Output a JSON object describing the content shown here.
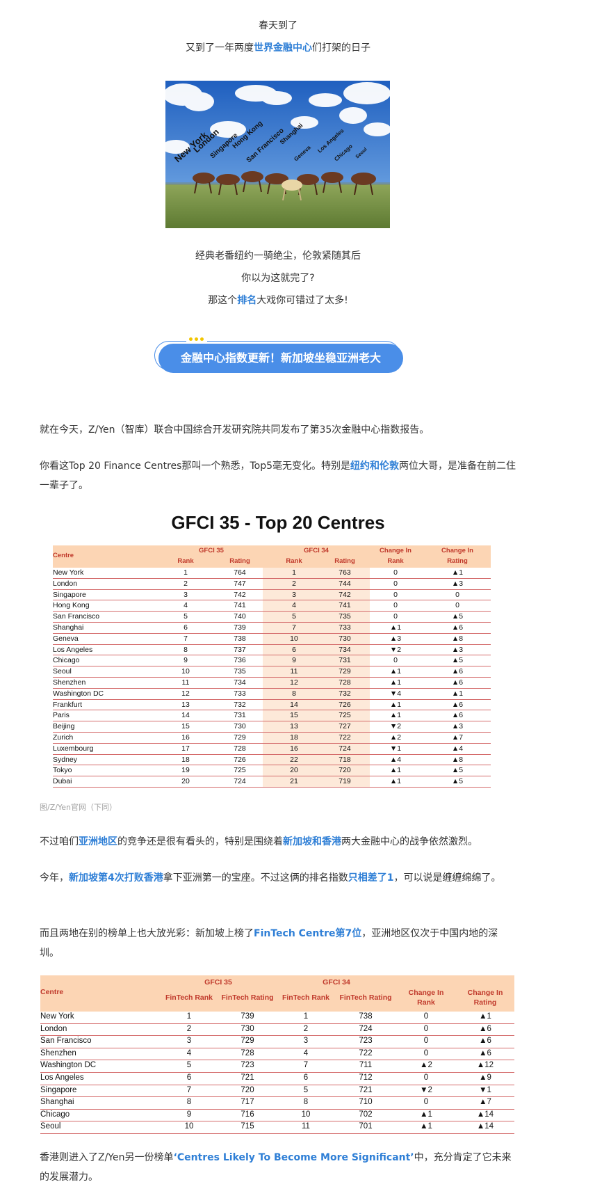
{
  "intro": {
    "line1": "春天到了",
    "line2_pre": "又到了一年两度",
    "line2_hl": "世界金融中心",
    "line2_post": "们打架的日子"
  },
  "photo": {
    "labels": [
      "New York",
      "London",
      "Singapore",
      "Hong Kong",
      "San Francisco",
      "Shanghai",
      "Geneva",
      "Los Angeles",
      "Chicago",
      "Seoul"
    ]
  },
  "after_photo": {
    "line1": "经典老番纽约一骑绝尘，伦敦紧随其后",
    "line2": "你以为这就完了?",
    "line3_pre": "那这个",
    "line3_hl": "排名",
    "line3_post": "大戏你可错过了太多!"
  },
  "badge": {
    "text": "金融中心指数更新！新加坡坐稳亚洲老大"
  },
  "para1": "就在今天，Z/Yen（智库）联合中国综合开发研究院共同发布了第35次金融中心指数报告。",
  "para2": {
    "pre": "你看这Top 20 Finance Centres那叫一个熟悉，Top5毫无变化。特别是",
    "hl": "纽约和伦敦",
    "post": "两位大哥，是准备在前二住一辈子了。"
  },
  "table1": {
    "title": "GFCI 35 - Top 20 Centres",
    "group_headers": [
      "GFCI 35",
      "GFCI 34",
      "Change In",
      "Change In"
    ],
    "sub_headers": [
      "Centre",
      "Rank",
      "Rating",
      "Rank",
      "Rating",
      "Rank",
      "Rating"
    ],
    "rows": [
      [
        "New York",
        "1",
        "764",
        "1",
        "763",
        "0",
        "▲1"
      ],
      [
        "London",
        "2",
        "747",
        "2",
        "744",
        "0",
        "▲3"
      ],
      [
        "Singapore",
        "3",
        "742",
        "3",
        "742",
        "0",
        "0"
      ],
      [
        "Hong Kong",
        "4",
        "741",
        "4",
        "741",
        "0",
        "0"
      ],
      [
        "San Francisco",
        "5",
        "740",
        "5",
        "735",
        "0",
        "▲5"
      ],
      [
        "Shanghai",
        "6",
        "739",
        "7",
        "733",
        "▲1",
        "▲6"
      ],
      [
        "Geneva",
        "7",
        "738",
        "10",
        "730",
        "▲3",
        "▲8"
      ],
      [
        "Los Angeles",
        "8",
        "737",
        "6",
        "734",
        "▼2",
        "▲3"
      ],
      [
        "Chicago",
        "9",
        "736",
        "9",
        "731",
        "0",
        "▲5"
      ],
      [
        "Seoul",
        "10",
        "735",
        "11",
        "729",
        "▲1",
        "▲6"
      ],
      [
        "Shenzhen",
        "11",
        "734",
        "12",
        "728",
        "▲1",
        "▲6"
      ],
      [
        "Washington DC",
        "12",
        "733",
        "8",
        "732",
        "▼4",
        "▲1"
      ],
      [
        "Frankfurt",
        "13",
        "732",
        "14",
        "726",
        "▲1",
        "▲6"
      ],
      [
        "Paris",
        "14",
        "731",
        "15",
        "725",
        "▲1",
        "▲6"
      ],
      [
        "Beijing",
        "15",
        "730",
        "13",
        "727",
        "▼2",
        "▲3"
      ],
      [
        "Zurich",
        "16",
        "729",
        "18",
        "722",
        "▲2",
        "▲7"
      ],
      [
        "Luxembourg",
        "17",
        "728",
        "16",
        "724",
        "▼1",
        "▲4"
      ],
      [
        "Sydney",
        "18",
        "726",
        "22",
        "718",
        "▲4",
        "▲8"
      ],
      [
        "Tokyo",
        "19",
        "725",
        "20",
        "720",
        "▲1",
        "▲5"
      ],
      [
        "Dubai",
        "20",
        "724",
        "21",
        "719",
        "▲1",
        "▲5"
      ]
    ]
  },
  "caption": "图/Z/Yen官网（下同）",
  "para3": {
    "pre": "不过咱们",
    "hl1": "亚洲地区",
    "mid": "的竞争还是很有看头的，特别是围绕着",
    "hl2": "新加坡和香港",
    "post": "两大金融中心的战争依然激烈。"
  },
  "para4": {
    "pre": "今年，",
    "hl1": "新加坡第4次打败香港",
    "mid": "拿下亚洲第一的宝座。不过这俩的排名指数",
    "hl2": "只相差了1",
    "post": "，可以说是缠缠绵绵了。"
  },
  "para5": {
    "pre": "而且两地在别的榜单上也大放光彩：新加坡上榜了",
    "hl": "FinTech Centre第7位",
    "post": "，亚洲地区仅次于中国内地的深圳。"
  },
  "table2": {
    "group_headers": [
      "GFCI 35",
      "GFCI 34"
    ],
    "sub_headers": [
      "Centre",
      "FinTech Rank",
      "FinTech Rating",
      "FinTech Rank",
      "FinTech Rating",
      "Change In Rank",
      "Change In Rating"
    ],
    "rows": [
      [
        "New York",
        "1",
        "739",
        "1",
        "738",
        "0",
        "▲1"
      ],
      [
        "London",
        "2",
        "730",
        "2",
        "724",
        "0",
        "▲6"
      ],
      [
        "San Francisco",
        "3",
        "729",
        "3",
        "723",
        "0",
        "▲6"
      ],
      [
        "Shenzhen",
        "4",
        "728",
        "4",
        "722",
        "0",
        "▲6"
      ],
      [
        "Washington DC",
        "5",
        "723",
        "7",
        "711",
        "▲2",
        "▲12"
      ],
      [
        "Los Angeles",
        "6",
        "721",
        "6",
        "712",
        "0",
        "▲9"
      ],
      [
        "Singapore",
        "7",
        "720",
        "5",
        "721",
        "▼2",
        "▼1"
      ],
      [
        "Shanghai",
        "8",
        "717",
        "8",
        "710",
        "0",
        "▲7"
      ],
      [
        "Chicago",
        "9",
        "716",
        "10",
        "702",
        "▲1",
        "▲14"
      ],
      [
        "Seoul",
        "10",
        "715",
        "11",
        "701",
        "▲1",
        "▲14"
      ]
    ]
  },
  "para6": {
    "pre": "香港则进入了Z/Yen另一份榜单",
    "hl": "‘Centres Likely To Become More Significant’",
    "post": "中，充分肯定了它未来的发展潜力。"
  }
}
